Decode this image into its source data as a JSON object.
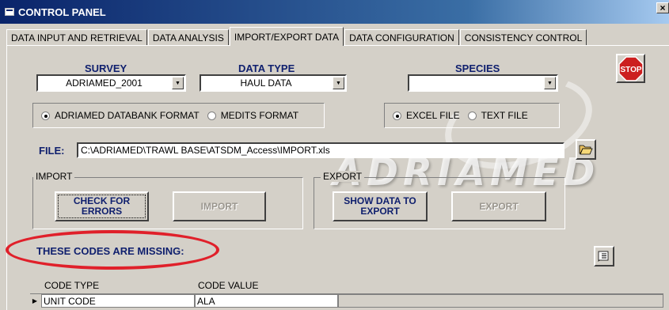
{
  "window": {
    "title": "CONTROL PANEL",
    "close": "×"
  },
  "tabs": [
    {
      "label": "DATA INPUT AND RETRIEVAL"
    },
    {
      "label": "DATA ANALYSIS"
    },
    {
      "label": "IMPORT/EXPORT DATA"
    },
    {
      "label": "DATA CONFIGURATION"
    },
    {
      "label": "CONSISTENCY CONTROL"
    }
  ],
  "active_tab": "IMPORT/EXPORT DATA",
  "survey": {
    "label": "SURVEY",
    "value": "ADRIAMED_2001"
  },
  "data_type": {
    "label": "DATA TYPE",
    "value": "HAUL DATA"
  },
  "species": {
    "label": "SPECIES",
    "value": ""
  },
  "stop": {
    "label": "STOP"
  },
  "format_options": {
    "adriamed": "ADRIAMED DATABANK FORMAT",
    "medits": "MEDITS FORMAT",
    "selected": "ADRIAMED DATABANK FORMAT"
  },
  "file_options": {
    "excel": "EXCEL FILE",
    "text": "TEXT FILE",
    "selected": "EXCEL FILE"
  },
  "file": {
    "label": "FILE:",
    "value": "C:\\ADRIAMED\\TRAWL BASE\\ATSDM_Access\\IMPORT.xls"
  },
  "watermark": "ADRIAMED",
  "import_section": {
    "label": "IMPORT",
    "check_button": "CHECK FOR ERRORS",
    "import_button": "IMPORT"
  },
  "export_section": {
    "label": "EXPORT",
    "show_button": "SHOW DATA TO EXPORT",
    "export_button": "EXPORT"
  },
  "missing_label": "THESE CODES ARE MISSING:",
  "grid": {
    "headers": [
      "CODE TYPE",
      "CODE VALUE"
    ],
    "rows": [
      {
        "code_type": "UNIT CODE",
        "code_value": "ALA"
      }
    ]
  },
  "colors": {
    "label_blue": "#10206e",
    "annotation_red": "#e0202a",
    "stop_red": "#cc1f1f"
  }
}
